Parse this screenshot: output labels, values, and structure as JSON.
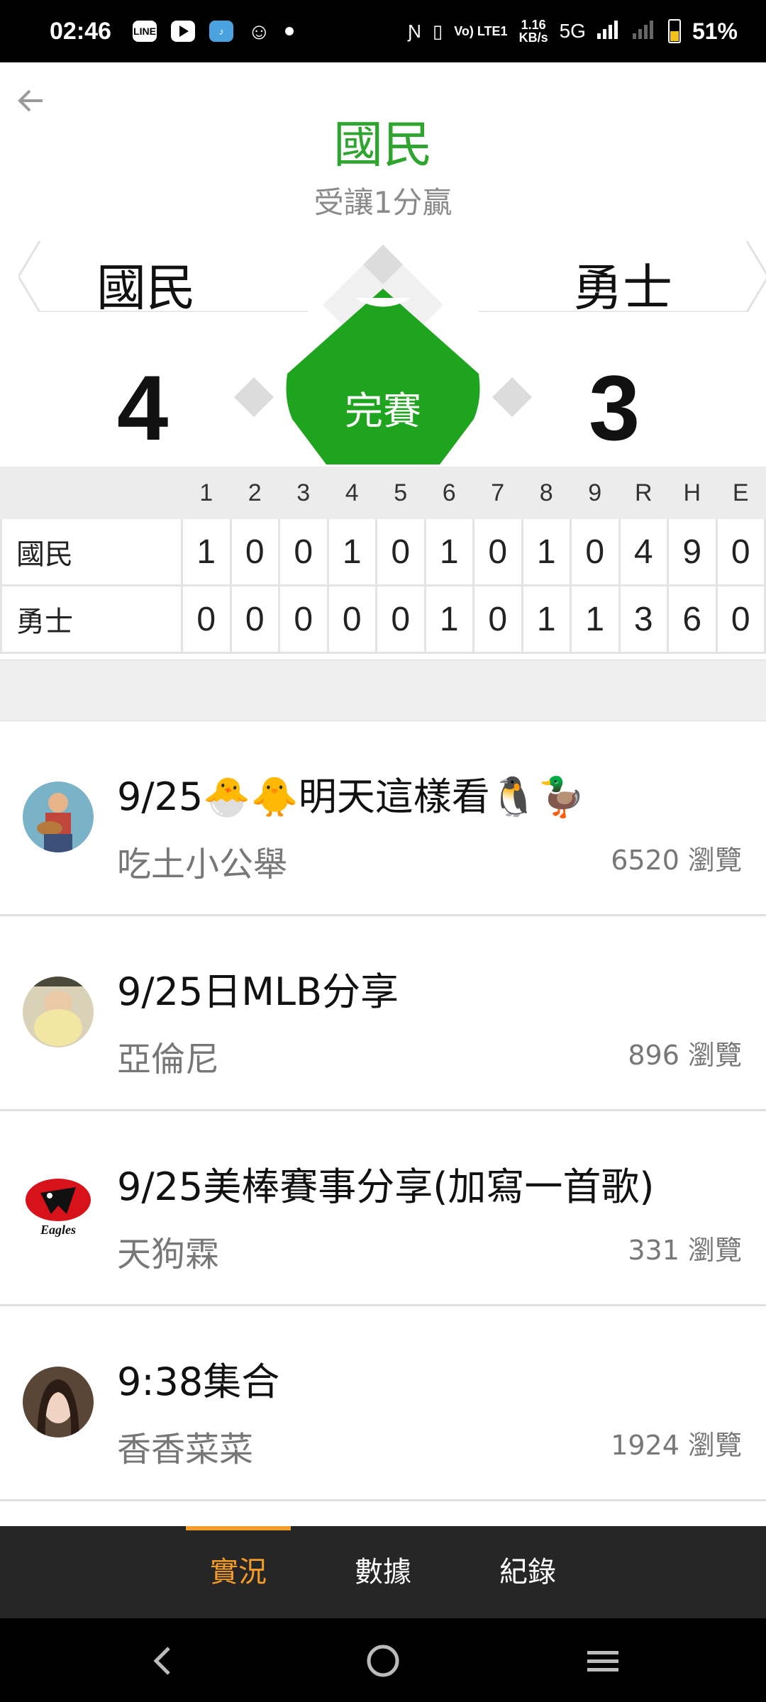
{
  "status_bar": {
    "time": "02:46",
    "apps": [
      "line-icon",
      "youtube-icon",
      "music-icon",
      "smiley-icon"
    ],
    "network_speed_top": "1.16",
    "network_speed_bottom": "KB/s",
    "network_type": "5G",
    "volte": "Vo) LTE1",
    "battery_percent": "51%",
    "battery_level": 0.51,
    "battery_color": "#f2c21a"
  },
  "header": {
    "back_icon": "back-arrow-icon",
    "winner": "國民",
    "handicap_result": "受讓1分贏"
  },
  "game": {
    "home_team": "國民",
    "away_team": "勇士",
    "home_score": "4",
    "away_score": "3",
    "status": "完賽",
    "status_color": "#1ea41e"
  },
  "linescore": {
    "columns": [
      "",
      "1",
      "2",
      "3",
      "4",
      "5",
      "6",
      "7",
      "8",
      "9",
      "R",
      "H",
      "E"
    ],
    "rows": [
      {
        "team": "國民",
        "values": [
          "1",
          "0",
          "0",
          "1",
          "0",
          "1",
          "0",
          "1",
          "0",
          "4",
          "9",
          "0"
        ]
      },
      {
        "team": "勇士",
        "values": [
          "0",
          "0",
          "0",
          "0",
          "0",
          "1",
          "0",
          "1",
          "1",
          "3",
          "6",
          "0"
        ]
      }
    ]
  },
  "articles": [
    {
      "title": "9/25🐣🐥明天這樣看🐧🦆",
      "author": "吃土小公舉",
      "views": "6520 瀏覽",
      "avatar_icon": "guitar-player-avatar"
    },
    {
      "title": "9/25日MLB分享",
      "author": "亞倫尼",
      "views": "896 瀏覽",
      "avatar_icon": "baby-avatar"
    },
    {
      "title": "9/25美棒賽事分享(加寫一首歌)",
      "author": "天狗霖",
      "views": "331 瀏覽",
      "avatar_icon": "eagles-logo-avatar",
      "avatar_text": "Eagles"
    },
    {
      "title": "9:38集合",
      "author": "香香菜菜",
      "views": "1924 瀏覽",
      "avatar_icon": "woman-portrait-avatar"
    }
  ],
  "tabs": [
    {
      "label": "實況",
      "active": true
    },
    {
      "label": "數據",
      "active": false
    },
    {
      "label": "紀錄",
      "active": false
    }
  ],
  "colors": {
    "accent_green": "#2ea52e",
    "tab_active": "#f39c2a",
    "tab_bar_bg": "#262626"
  },
  "nav": [
    "back-nav-icon",
    "home-nav-icon",
    "recents-nav-icon"
  ]
}
